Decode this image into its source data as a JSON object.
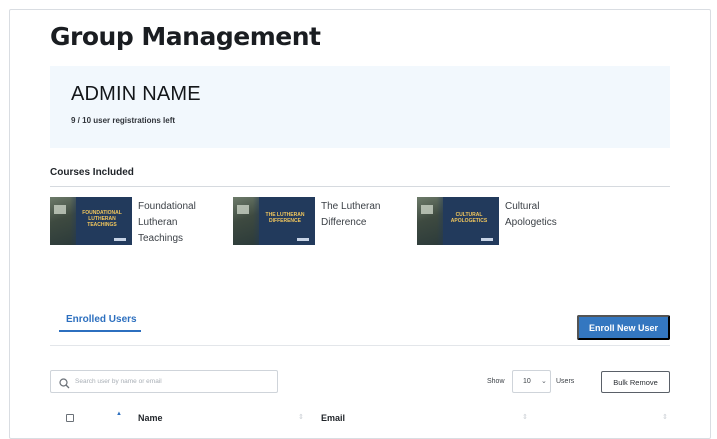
{
  "page": {
    "title": "Group Management"
  },
  "admin": {
    "name": "ADMIN NAME",
    "registrations": "9 / 10 user registrations left"
  },
  "courses": {
    "label": "Courses Included",
    "items": [
      {
        "thumb_text": "FOUNDATIONAL LUTHERAN TEACHINGS",
        "title": "Foundational Lutheran Teachings"
      },
      {
        "thumb_text": "THE LUTHERAN DIFFERENCE",
        "title": "The Lutheran Difference"
      },
      {
        "thumb_text": "CULTURAL APOLOGETICS",
        "title": "Cultural Apologetics"
      }
    ]
  },
  "tabs": {
    "enrolled_users": "Enrolled Users"
  },
  "actions": {
    "enroll_new_user": "Enroll New User",
    "bulk_remove": "Bulk Remove"
  },
  "search": {
    "placeholder": "Search user by name or email",
    "value": ""
  },
  "pager": {
    "show_label": "Show",
    "page_size": "10",
    "users_label": "Users"
  },
  "table": {
    "columns": [
      "Name",
      "Email"
    ]
  },
  "colors": {
    "accent": "#3477c0",
    "admin_bg": "#f2f8fd",
    "thumb_bg": "#223a5c",
    "thumb_title": "#f2c75c"
  },
  "icons": {
    "search": "search-icon",
    "dropdown": "chevron-down-icon",
    "sort": "sort-icon",
    "sort_asc": "sort-ascending-icon"
  }
}
